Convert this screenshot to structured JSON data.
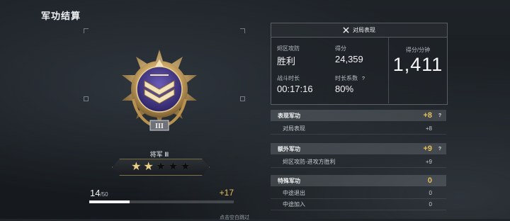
{
  "header": {
    "title": "军功结算"
  },
  "rank": {
    "name": "将军 Ⅲ",
    "stars_total": 5,
    "stars_filled": 2,
    "emblem_numeral": "III"
  },
  "progress": {
    "current": "14",
    "max": "/50",
    "gain": "+17",
    "fraction": 0.28
  },
  "footer": {
    "skip_hint": "点击空白跳过"
  },
  "stats_panel": {
    "title": "对局表现",
    "mode_label": "烬区攻防",
    "mode_value": "胜利",
    "score_label": "得分",
    "score_value": "24,359",
    "duration_label": "战斗时长",
    "duration_value": "00:17:16",
    "time_factor_label": "时长系数",
    "time_factor_value": "80%",
    "help": "?",
    "spm_label": "得分/分钟",
    "spm_value": "1,411"
  },
  "merit": {
    "sections": [
      {
        "label": "表现军功",
        "value": "+8",
        "help": "?",
        "items": [
          {
            "label": "对局表现",
            "value": "+8"
          }
        ]
      },
      {
        "label": "额外军功",
        "value": "+9",
        "help": "?",
        "items": [
          {
            "label": "烬区攻防-进攻方胜利",
            "value": "+9"
          }
        ]
      },
      {
        "label": "特殊军功",
        "value": "0",
        "help": "",
        "items": [
          {
            "label": "中途退出",
            "value": "0"
          },
          {
            "label": "中途加入",
            "value": "0"
          }
        ]
      }
    ]
  },
  "colors": {
    "accent_gold": "#e6c158",
    "emblem_purple": "#4a3c8c"
  }
}
